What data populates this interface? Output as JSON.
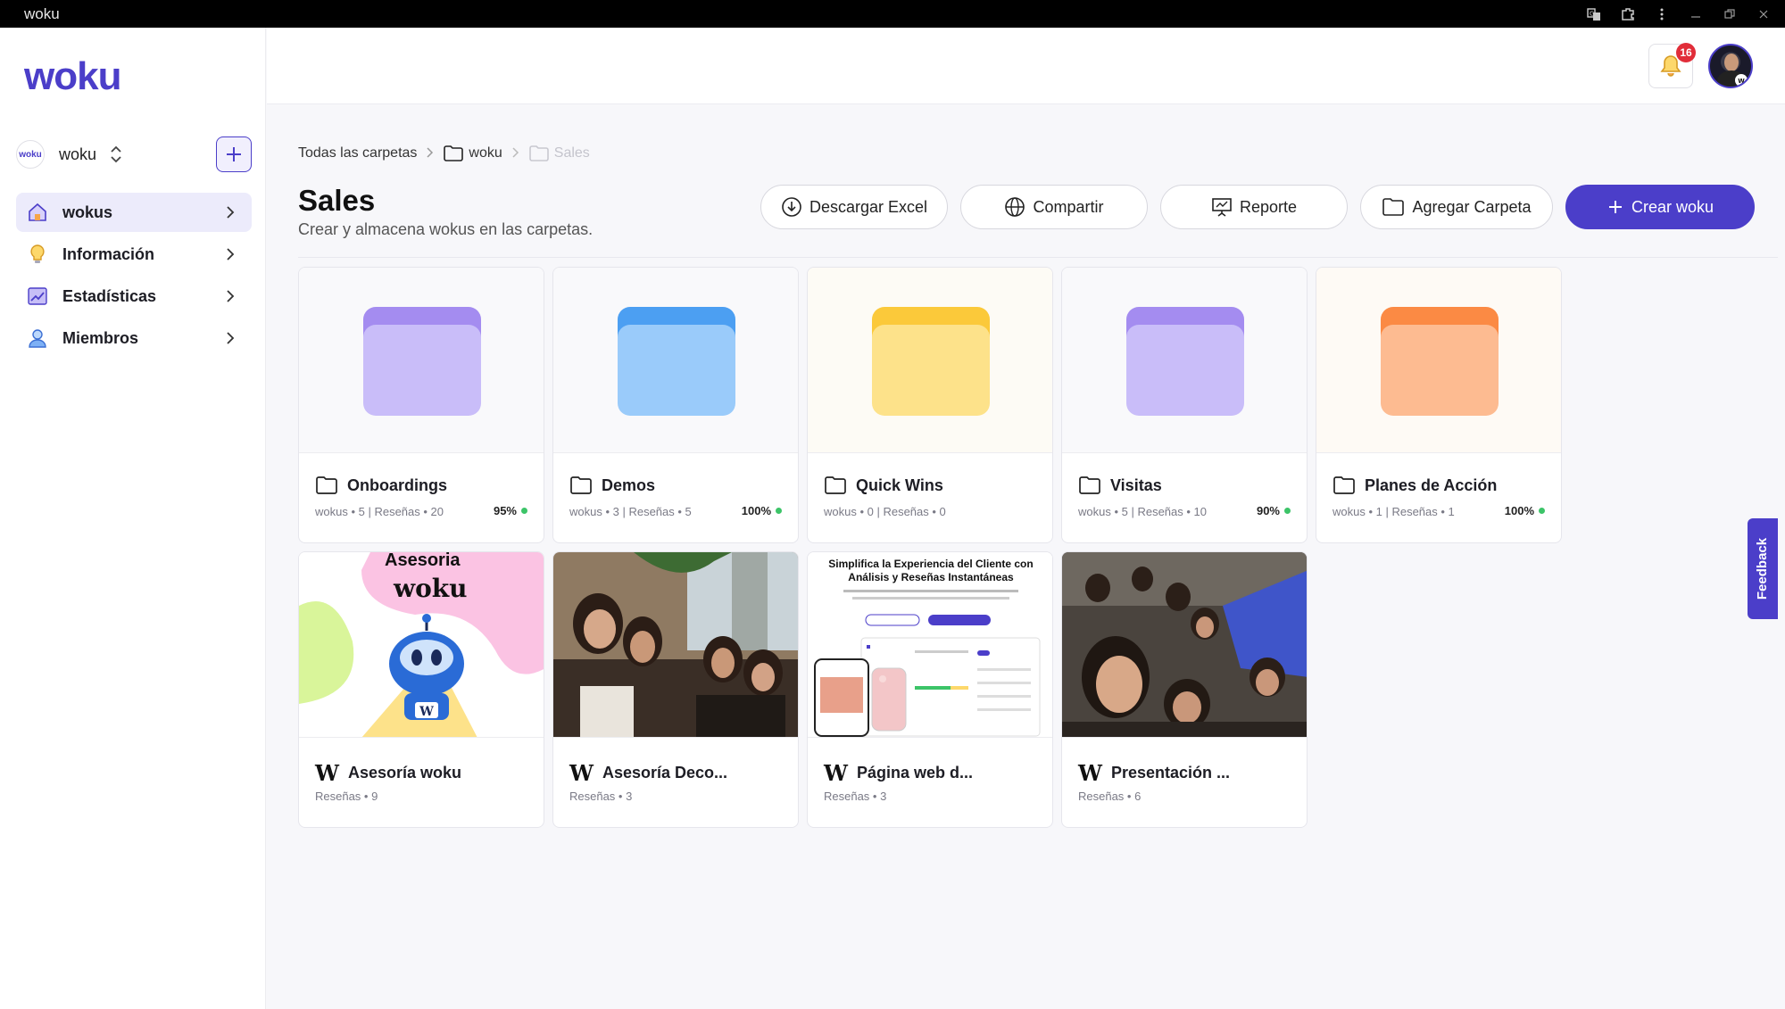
{
  "window": {
    "title": "woku"
  },
  "sidebar": {
    "logo": "woku",
    "workspace": {
      "avatar_text": "woku",
      "name": "woku"
    },
    "items": [
      {
        "label": "wokus",
        "icon": "home-icon",
        "active": true
      },
      {
        "label": "Información",
        "icon": "lightbulb-icon",
        "active": false
      },
      {
        "label": "Estadísticas",
        "icon": "chart-icon",
        "active": false
      },
      {
        "label": "Miembros",
        "icon": "user-icon",
        "active": false
      }
    ]
  },
  "header": {
    "notifications_count": "16"
  },
  "breadcrumb": {
    "root": "Todas las carpetas",
    "parent": "woku",
    "current": "Sales"
  },
  "page": {
    "title": "Sales",
    "subtitle": "Crear y almacena wokus en las carpetas."
  },
  "actions": {
    "download": "Descargar Excel",
    "share": "Compartir",
    "report": "Reporte",
    "add_folder": "Agregar Carpeta",
    "create": "Crear woku"
  },
  "folders": [
    {
      "name": "Onboardings",
      "meta": "wokus • 5 | Reseñas • 20",
      "pct": "95%",
      "color": "#b9a8f5"
    },
    {
      "name": "Demos",
      "meta": "wokus • 3 | Reseñas • 5",
      "pct": "100%",
      "color": "#7db8f7"
    },
    {
      "name": "Quick Wins",
      "meta": "wokus • 0 | Reseñas • 0",
      "pct": "",
      "color": "#fdd86b"
    },
    {
      "name": "Visitas",
      "meta": "wokus • 5 | Reseñas • 10",
      "pct": "90%",
      "color": "#b9a8f5"
    },
    {
      "name": "Planes de Acción",
      "meta": "wokus • 1 | Reseñas • 1",
      "pct": "100%",
      "color": "#fda676"
    }
  ],
  "wokus": [
    {
      "name": "Asesoría woku",
      "meta": "Reseñas • 9",
      "thumb_title_1": "Asesoria",
      "thumb_title_2": "woku"
    },
    {
      "name": "Asesoría Deco...",
      "meta": "Reseñas • 3"
    },
    {
      "name": "Página web d...",
      "meta": "Reseñas • 3",
      "thumb_title_1": "Simplifica la Experiencia del Cliente con",
      "thumb_title_2": "Análisis y Reseñas Instantáneas"
    },
    {
      "name": "Presentación ...",
      "meta": "Reseñas • 6"
    }
  ],
  "feedback_label": "Feedback",
  "colors": {
    "accent": "#4b3ec9",
    "success": "#3cc468",
    "badge": "#e12d39"
  }
}
